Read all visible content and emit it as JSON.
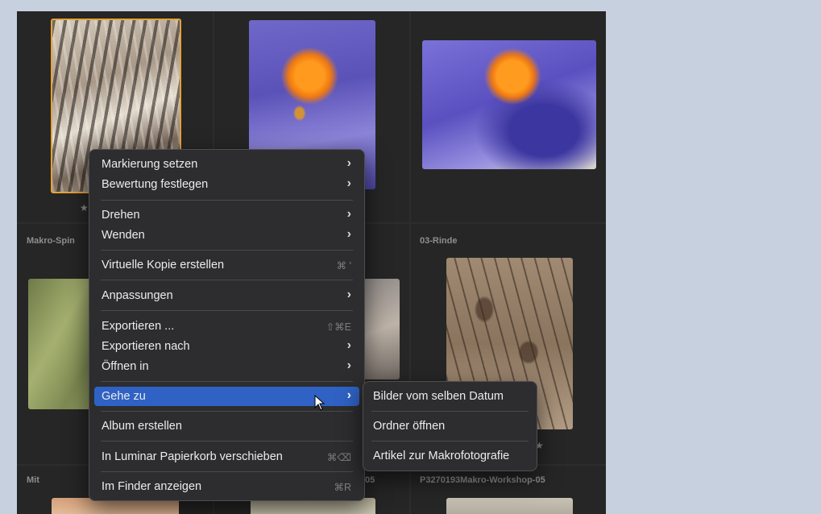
{
  "grid": {
    "captions": {
      "row2_left": "Makro-Spin",
      "row2_right": "03-Rinde",
      "row3_left": "Mit",
      "row3_mid": "05",
      "row3_right": "P3270193Makro-Workshop-05"
    },
    "star_glyph": "★"
  },
  "context_menu": {
    "items": [
      {
        "label": "Markierung setzen",
        "arrow": "›"
      },
      {
        "label": "Bewertung festlegen",
        "arrow": "›"
      },
      {
        "label": "Drehen",
        "arrow": "›"
      },
      {
        "label": "Wenden",
        "arrow": "›"
      },
      {
        "label": "Virtuelle Kopie erstellen",
        "shortcut": "⌘ '"
      },
      {
        "label": "Anpassungen",
        "arrow": "›"
      },
      {
        "label": "Exportieren ...",
        "shortcut": "⇧⌘E"
      },
      {
        "label": "Exportieren nach",
        "arrow": "›"
      },
      {
        "label": "Öffnen in",
        "arrow": "›"
      },
      {
        "label": "Gehe zu",
        "arrow": "›",
        "highlighted": true
      },
      {
        "label": "Album erstellen"
      },
      {
        "label": "In Luminar Papierkorb verschieben",
        "shortcut": "⌘⌫"
      },
      {
        "label": "Im Finder anzeigen",
        "shortcut": "⌘R"
      }
    ]
  },
  "submenu": {
    "items": [
      {
        "label": "Bilder vom selben Datum"
      },
      {
        "label": "Ordner öffnen"
      },
      {
        "label": "Artikel zur Makrofotografie"
      }
    ]
  },
  "colors": {
    "highlight": "#2f62c4",
    "selection_border": "#e6a23a",
    "background": "#c7d0df"
  }
}
